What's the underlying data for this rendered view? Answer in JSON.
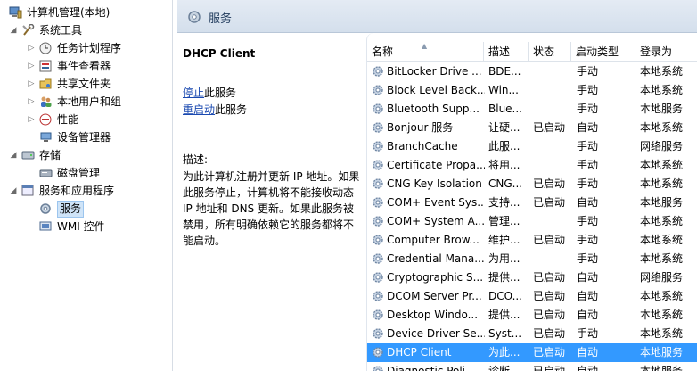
{
  "tree": {
    "root": "计算机管理(本地)",
    "items": [
      {
        "label": "系统工具",
        "level": 1,
        "arrow": "◢",
        "icon": "tools-icon"
      },
      {
        "label": "任务计划程序",
        "level": 2,
        "arrow": "▷",
        "icon": "clock-icon"
      },
      {
        "label": "事件查看器",
        "level": 2,
        "arrow": "▷",
        "icon": "event-viewer-icon"
      },
      {
        "label": "共享文件夹",
        "level": 2,
        "arrow": "▷",
        "icon": "shared-folder-icon"
      },
      {
        "label": "本地用户和组",
        "level": 2,
        "arrow": "▷",
        "icon": "users-icon"
      },
      {
        "label": "性能",
        "level": 2,
        "arrow": "▷",
        "icon": "performance-icon"
      },
      {
        "label": "设备管理器",
        "level": 2,
        "arrow": "",
        "icon": "device-manager-icon"
      },
      {
        "label": "存储",
        "level": 1,
        "arrow": "◢",
        "icon": "storage-icon"
      },
      {
        "label": "磁盘管理",
        "level": 2,
        "arrow": "",
        "icon": "disk-icon"
      },
      {
        "label": "服务和应用程序",
        "level": 1,
        "arrow": "◢",
        "icon": "services-apps-icon"
      },
      {
        "label": "服务",
        "level": 2,
        "arrow": "",
        "icon": "services-gear-icon",
        "selected": true
      },
      {
        "label": "WMI 控件",
        "level": 2,
        "arrow": "",
        "icon": "wmi-icon"
      }
    ]
  },
  "header": {
    "title": "服务"
  },
  "description_panel": {
    "service_name": "DHCP Client",
    "actions": [
      {
        "link": "停止",
        "suffix": "此服务"
      },
      {
        "link": "重启动",
        "suffix": "此服务"
      }
    ],
    "desc_label": "描述:",
    "desc_text": "为此计算机注册并更新 IP 地址。如果此服务停止，计算机将不能接收动态 IP 地址和 DNS 更新。如果此服务被禁用，所有明确依赖它的服务都将不能启动。"
  },
  "list": {
    "columns": [
      "名称",
      "描述",
      "状态",
      "启动类型",
      "登录为"
    ],
    "sort_indicator": "▲",
    "rows": [
      {
        "name": "BitLocker Drive ...",
        "desc": "BDE...",
        "status": "",
        "startup": "手动",
        "logon": "本地系统"
      },
      {
        "name": "Block Level Back...",
        "desc": "Win...",
        "status": "",
        "startup": "手动",
        "logon": "本地系统"
      },
      {
        "name": "Bluetooth Supp...",
        "desc": "Blue...",
        "status": "",
        "startup": "手动",
        "logon": "本地服务"
      },
      {
        "name": "Bonjour 服务",
        "desc": "让硬...",
        "status": "已启动",
        "startup": "自动",
        "logon": "本地系统"
      },
      {
        "name": "BranchCache",
        "desc": "此服...",
        "status": "",
        "startup": "手动",
        "logon": "网络服务"
      },
      {
        "name": "Certificate Propa...",
        "desc": "将用...",
        "status": "",
        "startup": "手动",
        "logon": "本地系统"
      },
      {
        "name": "CNG Key Isolation",
        "desc": "CNG...",
        "status": "已启动",
        "startup": "手动",
        "logon": "本地系统"
      },
      {
        "name": "COM+ Event Sys...",
        "desc": "支持...",
        "status": "已启动",
        "startup": "自动",
        "logon": "本地服务"
      },
      {
        "name": "COM+ System A...",
        "desc": "管理...",
        "status": "",
        "startup": "手动",
        "logon": "本地系统"
      },
      {
        "name": "Computer Brow...",
        "desc": "维护...",
        "status": "已启动",
        "startup": "手动",
        "logon": "本地系统"
      },
      {
        "name": "Credential Mana...",
        "desc": "为用...",
        "status": "",
        "startup": "手动",
        "logon": "本地系统"
      },
      {
        "name": "Cryptographic S...",
        "desc": "提供...",
        "status": "已启动",
        "startup": "自动",
        "logon": "网络服务"
      },
      {
        "name": "DCOM Server Pr...",
        "desc": "DCO...",
        "status": "已启动",
        "startup": "自动",
        "logon": "本地系统"
      },
      {
        "name": "Desktop Windo...",
        "desc": "提供...",
        "status": "已启动",
        "startup": "自动",
        "logon": "本地系统"
      },
      {
        "name": "Device Driver Se...",
        "desc": "Syst...",
        "status": "已启动",
        "startup": "手动",
        "logon": "本地系统"
      },
      {
        "name": "DHCP Client",
        "desc": "为此...",
        "status": "已启动",
        "startup": "自动",
        "logon": "本地服务",
        "selected": true
      },
      {
        "name": "Diagnostic Poli...",
        "desc": "诊断...",
        "status": "已启动",
        "startup": "自动",
        "logon": "本地服务"
      }
    ]
  },
  "colors": {
    "selection": "#3399ff",
    "link": "#1a49b0",
    "header_text": "#1e395b"
  }
}
